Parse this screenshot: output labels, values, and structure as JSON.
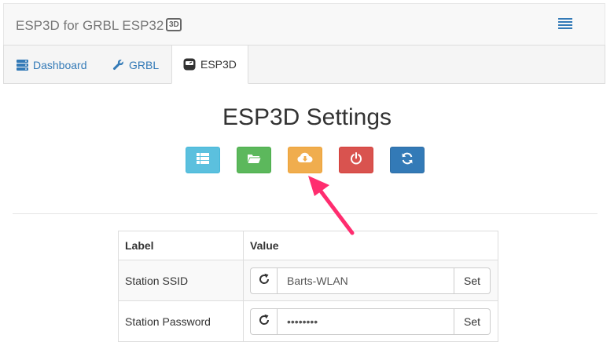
{
  "navbar": {
    "brand": "ESP3D for GRBL ESP32",
    "badge": "3D",
    "menu_icon": "hamburger-menu-icon"
  },
  "tabs": [
    {
      "label": "Dashboard",
      "icon": "server-icon",
      "active": false
    },
    {
      "label": "GRBL",
      "icon": "wrench-icon",
      "active": false
    },
    {
      "label": "ESP3D",
      "icon": "esp3d-device-icon",
      "active": true
    }
  ],
  "page": {
    "title": "ESP3D Settings"
  },
  "actions": [
    {
      "icon": "list-icon",
      "color": "#5bc0de"
    },
    {
      "icon": "folder-open-icon",
      "color": "#5cb85c"
    },
    {
      "icon": "cloud-download-icon",
      "color": "#f0ad4e"
    },
    {
      "icon": "power-icon",
      "color": "#d9534f"
    },
    {
      "icon": "refresh-icon",
      "color": "#337ab7"
    }
  ],
  "table": {
    "headers": [
      "Label",
      "Value"
    ],
    "rows": [
      {
        "label": "Station SSID",
        "value": "Barts-WLAN",
        "button": "Set"
      },
      {
        "label": "Station Password",
        "value": "********",
        "button": "Set"
      }
    ]
  },
  "colors": {
    "link": "#337ab7",
    "annotation_arrow": "#ff2d6f"
  }
}
